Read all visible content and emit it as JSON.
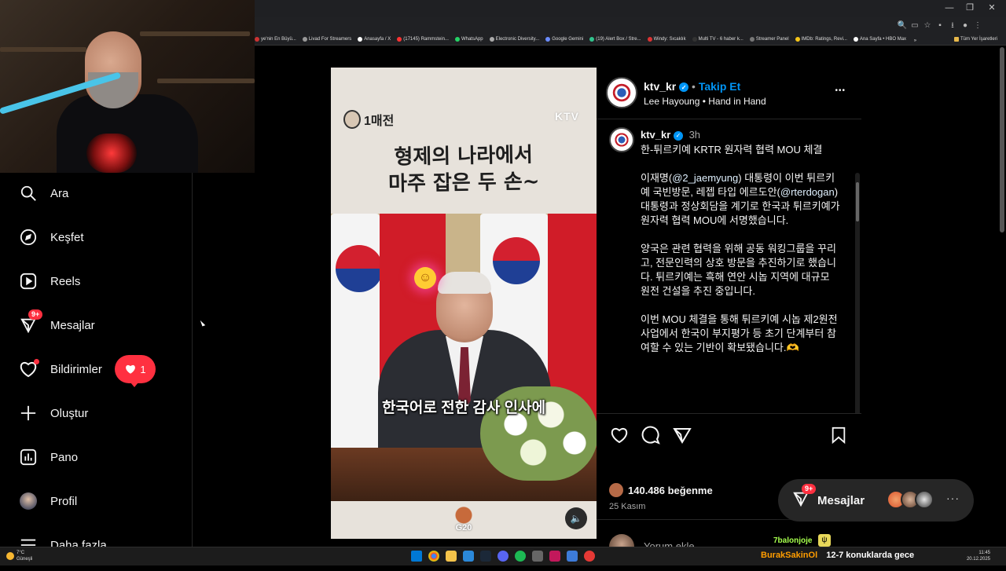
{
  "browser": {
    "window_controls": [
      "—",
      "❐",
      "✕"
    ],
    "bookmarks": [
      {
        "label": "ye'nin En Büyü...",
        "color": "#c33"
      },
      {
        "label": "Livad For Streamers",
        "color": "#999"
      },
      {
        "label": "Anasayfa / X",
        "color": "#fff"
      },
      {
        "label": "(17145) Rammstein...",
        "color": "#f33"
      },
      {
        "label": "WhatsApp",
        "color": "#25d366"
      },
      {
        "label": "Electronic Diversity...",
        "color": "#aaa"
      },
      {
        "label": "Google Gemini",
        "color": "#6b8cff"
      },
      {
        "label": "(19) Alert Box / Stre...",
        "color": "#31c48d"
      },
      {
        "label": "Windy: Sıcaklık",
        "color": "#d33"
      },
      {
        "label": "Multi TV - 6 haber k...",
        "color": "#333"
      },
      {
        "label": "Streamer Panel",
        "color": "#777"
      },
      {
        "label": "IMDb: Ratings, Revi...",
        "color": "#f5c518"
      },
      {
        "label": "Ana Sayfa • HBO Max",
        "color": "#fff"
      }
    ],
    "bookmarks_more": "»",
    "all_bookmarks": "Tüm Yer İşaretleri"
  },
  "sidebar": {
    "items": [
      {
        "label": "Ara",
        "icon": "search-icon"
      },
      {
        "label": "Keşfet",
        "icon": "compass-icon"
      },
      {
        "label": "Reels",
        "icon": "reels-icon"
      },
      {
        "label": "Mesajlar",
        "icon": "messenger-icon",
        "badge": "9+"
      },
      {
        "label": "Bildirimler",
        "icon": "heart-icon",
        "pill_count": "1"
      },
      {
        "label": "Oluştur",
        "icon": "plus-icon"
      },
      {
        "label": "Pano",
        "icon": "dashboard-icon"
      },
      {
        "label": "Profil",
        "icon": "avatar"
      },
      {
        "label": "Daha fazla",
        "icon": "menu-icon"
      }
    ]
  },
  "media": {
    "brand": "1매전",
    "watermark": "KTV",
    "headline_line1": "형제의 나라에서",
    "headline_line2": "마주 잡은 두 손~",
    "subtitle": "한국어로 전한 감사 인사에",
    "emoji": "☺",
    "g20": "G20",
    "mute_icon": "🔈"
  },
  "post": {
    "header": {
      "username": "ktv_kr",
      "separator": "•",
      "follow": "Takip Et",
      "audio": "Lee Hayoung • Hand in Hand",
      "more": "•••"
    },
    "caption": {
      "username": "ktv_kr",
      "time": "3h",
      "title": "한-튀르키예 KRTR 원자력 협력 MOU 체결",
      "p1_pre": "이재명(",
      "p1_mention1": "@2_jaemyung",
      "p1_mid": ") 대통령이 이번 튀르키예 국빈방문, 레젭 타입 에르도안(",
      "p1_mention2": "@rterdogan",
      "p1_post": ") 대통령과 정상회담을 계기로 한국과 튀르키예가 원자력 협력 MOU에 서명했습니다.",
      "p2": "양국은 관련 협력을 위해 공동 워킹그룹을 꾸리고, 전문인력의 상호 방문을 추진하기로 했습니다. 튀르키예는 흑해 연안 시놉 지역에 대규모 원전 건설을 추진 중입니다.",
      "p3": "이번 MOU 체결을 통해 튀르키예 시놉 제2원전 사업에서 한국이 부지평가 등 초기 단계부터 참여할 수 있는 기반이 확보됐습니다.",
      "p3_emoji": "🫶"
    },
    "likes": "140.486 beğenme",
    "date": "25 Kasım",
    "comment_placeholder": "Yorum ekle..."
  },
  "messages_float": {
    "label": "Mesajlar",
    "badge": "9+",
    "more": "···"
  },
  "overlay": {
    "chat_name": "7balonjoje",
    "chat_badge": "ψ"
  },
  "taskbar": {
    "weather_temp": "7°C",
    "weather_text": "Güneşli",
    "ticker_user": "BurakSakinOl",
    "ticker_text": "12-7 konuklarda gece",
    "time": "11:45",
    "date": "20.12.2025"
  },
  "colors": {
    "accent_blue": "#0095f6",
    "notif_red": "#ff3040",
    "background": "#000000"
  }
}
